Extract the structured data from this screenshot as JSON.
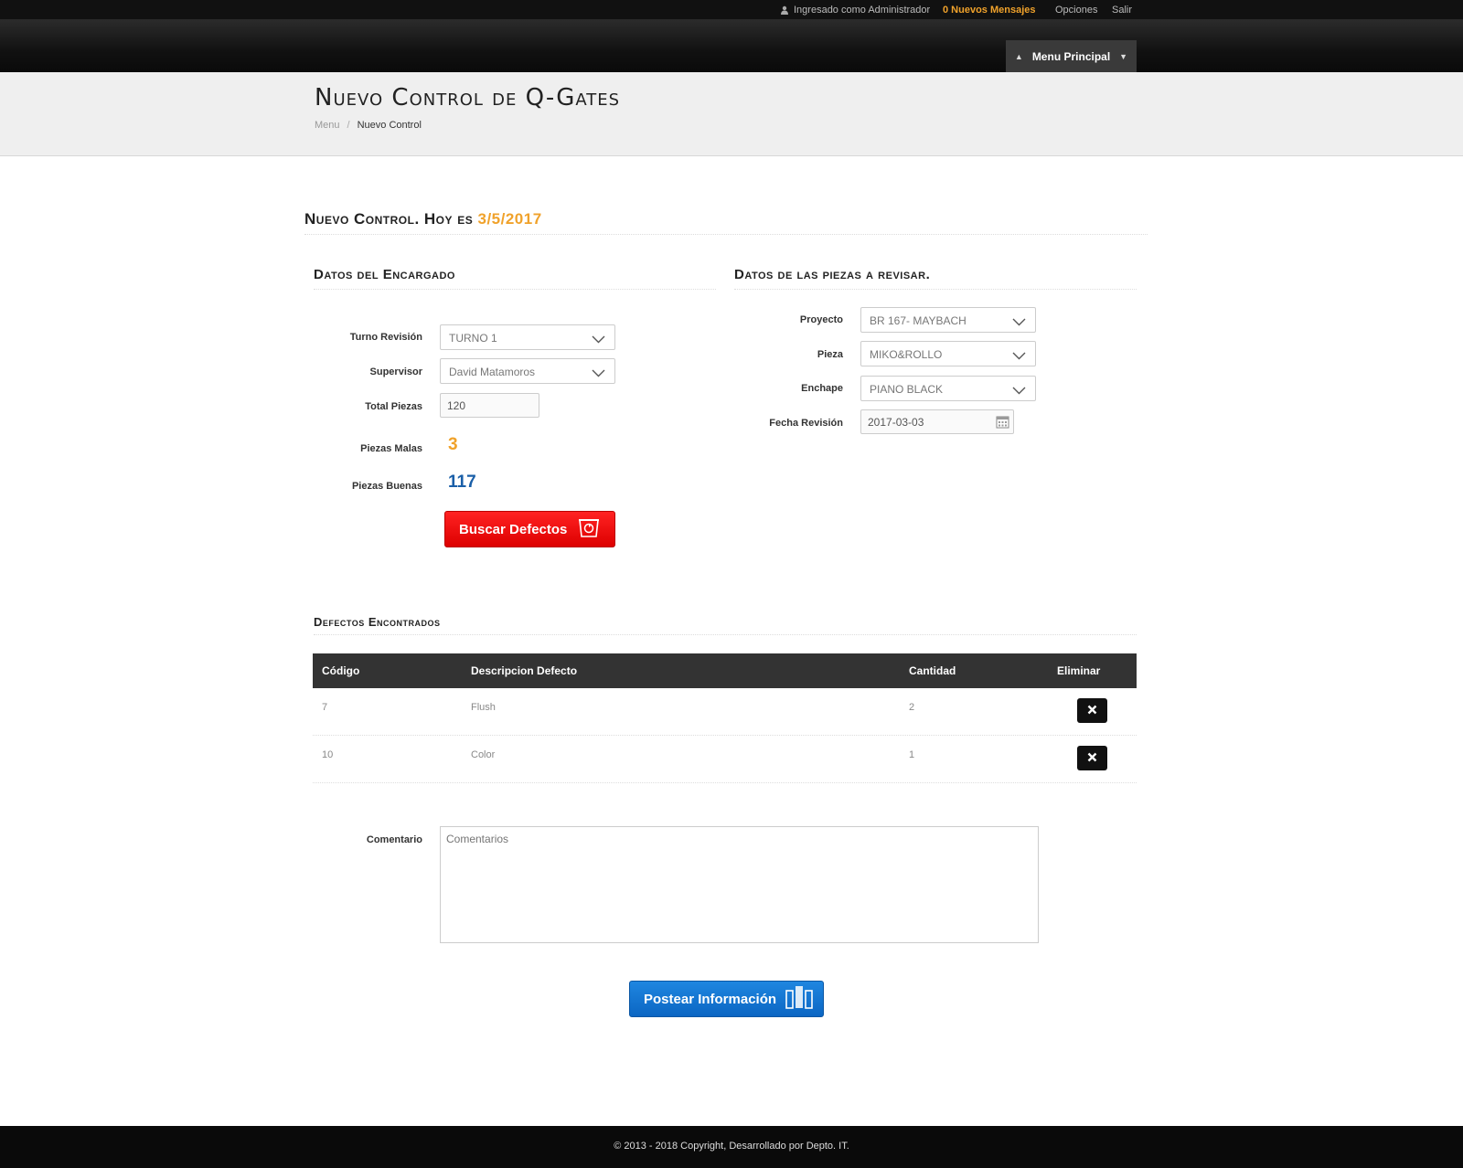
{
  "topbar": {
    "user_text": "Ingresado como Administrador",
    "messages": "0 Nuevos Mensajes",
    "options": "Opciones",
    "logout": "Salir"
  },
  "header": {
    "menu_label": "Menu Principal"
  },
  "page": {
    "title": "Nuevo Control de Q-Gates",
    "breadcrumb": [
      "Menu",
      "Nuevo Control"
    ]
  },
  "section": {
    "heading_prefix": "Nuevo Control. Hoy es",
    "date": "3/5/2017"
  },
  "encargado": {
    "heading": "Datos del Encargado",
    "turno_label": "Turno Revisión",
    "turno_value": "TURNO 1",
    "supervisor_label": "Supervisor",
    "supervisor_value": "David Matamoros",
    "total_label": "Total Piezas",
    "total_value": "120",
    "malas_label": "Piezas Malas",
    "malas_value": "3",
    "buenas_label": "Piezas Buenas",
    "buenas_value": "117",
    "buscar_label": "Buscar Defectos"
  },
  "piezas": {
    "heading": "Datos de las piezas a revisar.",
    "proyecto_label": "Proyecto",
    "proyecto_value": "BR 167- MAYBACH",
    "pieza_label": "Pieza",
    "pieza_value": "MIKO&ROLLO",
    "enchape_label": "Enchape",
    "enchape_value": "PIANO BLACK",
    "fecha_label": "Fecha Revisión",
    "fecha_value": "2017-03-03"
  },
  "defectos": {
    "heading": "Defectos Encontrados",
    "columns": [
      "Código",
      "Descripcion Defecto",
      "Cantidad",
      "Eliminar"
    ],
    "rows": [
      {
        "codigo": "7",
        "descripcion": "Flush",
        "cantidad": "2"
      },
      {
        "codigo": "10",
        "descripcion": "Color",
        "cantidad": "1"
      }
    ]
  },
  "comentario": {
    "label": "Comentario",
    "placeholder": "Comentarios"
  },
  "post_label": "Postear Información",
  "footer": "© 2013 - 2018 Copyright, Desarrollado por Depto. IT.",
  "colors": {
    "accent_orange": "#f0a22b",
    "accent_blue": "#1a5fa8",
    "button_red": "#e30000",
    "button_blue": "#0b72d6"
  }
}
